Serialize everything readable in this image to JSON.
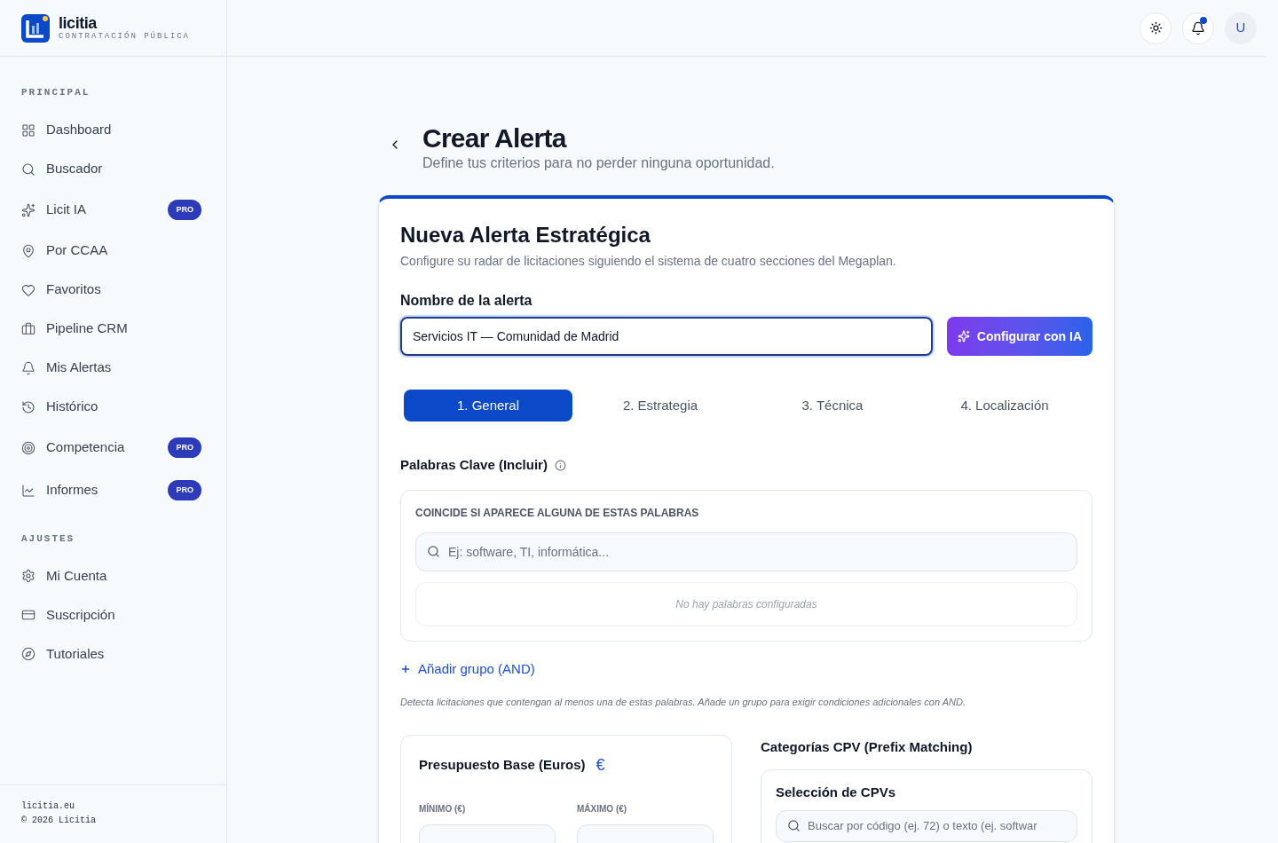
{
  "brand": {
    "name": "licitia",
    "tagline": "CONTRATACIÓN PÚBLICA"
  },
  "sidebar": {
    "sections": [
      {
        "title": "PRINCIPAL",
        "items": [
          {
            "label": "Dashboard",
            "selected": false
          },
          {
            "label": "Buscador",
            "selected": false
          },
          {
            "label": "Licit IA",
            "selected": false,
            "badge": "PRO"
          },
          {
            "label": "Por CCAA",
            "selected": false
          },
          {
            "label": "Favoritos",
            "selected": false
          },
          {
            "label": "Pipeline CRM",
            "selected": false
          },
          {
            "label": "Mis Alertas",
            "selected": false
          },
          {
            "label": "Histórico",
            "selected": false
          },
          {
            "label": "Competencia",
            "selected": false,
            "badge": "PRO"
          },
          {
            "label": "Informes",
            "selected": false,
            "badge": "PRO"
          }
        ]
      },
      {
        "title": "AJUSTES",
        "items": [
          {
            "label": "Mi Cuenta",
            "selected": false
          },
          {
            "label": "Suscripción",
            "selected": false
          },
          {
            "label": "Tutoriales",
            "selected": false
          }
        ]
      }
    ],
    "footer": [
      "licitia.eu",
      "© 2026 Licitia"
    ]
  },
  "header": {
    "notifications_unread": true,
    "avatar": "U"
  },
  "page": {
    "title": "Crear Alerta",
    "subtitle": "Define tus criterios para no perder ninguna oportunidad."
  },
  "card": {
    "title": "Nueva Alerta Estratégica",
    "subtitle": "Configure su radar de licitaciones siguiendo el sistema de cuatro secciones del Megaplan.",
    "name_label": "Nombre de la alerta",
    "name_value": "Servicios IT — Comunidad de Madrid",
    "ai_button": "Configurar con IA",
    "tabs": [
      {
        "label": "1. General",
        "selected": true
      },
      {
        "label": "2. Estrategia",
        "selected": false
      },
      {
        "label": "3. Técnica",
        "selected": false
      },
      {
        "label": "4. Localización",
        "selected": false
      }
    ],
    "keywords": {
      "title": "Palabras Clave (Incluir)",
      "group_label": "COINCIDE SI APARECE ALGUNA DE ESTAS PALABRAS",
      "placeholder": "Ej: software, TI, informática...",
      "empty": "No hay palabras configuradas",
      "add_group": "Añadir grupo (AND)",
      "help": "Detecta licitaciones que contengan al menos una de estas palabras. Añade un grupo para exigir condiciones adicionales con AND."
    },
    "budget": {
      "title": "Presupuesto Base (Euros)",
      "symbol": "€",
      "min_label": "MÍNIMO (€)",
      "max_label": "MÁXIMO (€)"
    },
    "cpv": {
      "title": "Categorías CPV (Prefix Matching)",
      "box_title": "Selección de CPVs",
      "placeholder": "Buscar por código (ej. 72) o texto (ej. softwar"
    }
  }
}
